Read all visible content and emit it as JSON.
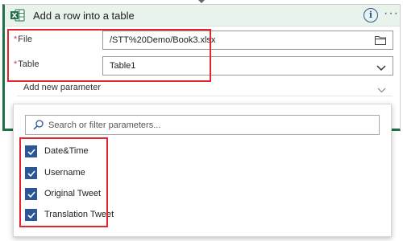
{
  "header": {
    "title": "Add a row into a table",
    "info_glyph": "i",
    "more_glyph": "···",
    "accent_color": "#1e7145",
    "icons": [
      "excel-icon",
      "info-icon",
      "more-icon"
    ]
  },
  "fields": {
    "file": {
      "required_mark": "*",
      "label": "File",
      "value": "/STT%20Demo/Book3.xlsx",
      "icon": "folder-icon"
    },
    "table": {
      "required_mark": "*",
      "label": "Table",
      "value": "Table1",
      "icon": "chevron-down-icon"
    }
  },
  "add_parameter": {
    "label": "Add new parameter",
    "icon": "chevron-down-icon"
  },
  "dropdown": {
    "search_placeholder": "Search or filter parameters...",
    "items": [
      {
        "label": "Date&Time",
        "checked": true
      },
      {
        "label": "Username",
        "checked": true
      },
      {
        "label": "Original Tweet",
        "checked": true
      },
      {
        "label": "Translation Tweet",
        "checked": true
      }
    ]
  },
  "highlight_color": "#e3242b"
}
